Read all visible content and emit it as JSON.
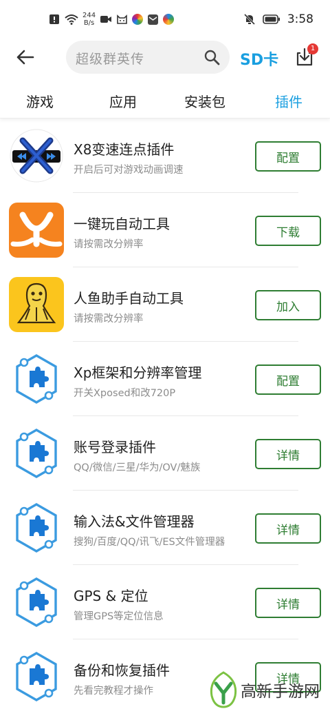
{
  "status_bar": {
    "net_speed_value": "244",
    "net_speed_unit": "B/s",
    "time": "3:58"
  },
  "header": {
    "search_placeholder": "超级群英传",
    "sd_card_label": "SD卡",
    "download_badge_count": "1"
  },
  "tabs": [
    {
      "label": "游戏",
      "active": false
    },
    {
      "label": "应用",
      "active": false
    },
    {
      "label": "安装包",
      "active": false
    },
    {
      "label": "插件",
      "active": true
    }
  ],
  "plugins": [
    {
      "icon": "x8-speed-icon",
      "title": "X8变速连点插件",
      "subtitle": "开启后可对游戏动画调速",
      "action": "配置"
    },
    {
      "icon": "y-logo-icon",
      "title": "一键玩自动工具",
      "subtitle": "请按需改分辨率",
      "action": "下载"
    },
    {
      "icon": "mermaid-icon",
      "title": "人鱼助手自动工具",
      "subtitle": "请按需改分辨率",
      "action": "加入"
    },
    {
      "icon": "puzzle-plugin-icon",
      "title": "Xp框架和分辨率管理",
      "subtitle": "开关Xposed和改720P",
      "action": "配置"
    },
    {
      "icon": "puzzle-plugin-icon",
      "title": "账号登录插件",
      "subtitle": "QQ/微信/三星/华为/OV/魅族",
      "action": "详情"
    },
    {
      "icon": "puzzle-plugin-icon",
      "title": "输入法&文件管理器",
      "subtitle": "搜狗/百度/QQ/讯飞/ES文件管理器",
      "action": "详情"
    },
    {
      "icon": "puzzle-plugin-icon",
      "title": "GPS & 定位",
      "subtitle": "管理GPS等定位信息",
      "action": "详情"
    },
    {
      "icon": "puzzle-plugin-icon",
      "title": "备份和恢复插件",
      "subtitle": "先看完教程才操作",
      "action": "详情"
    }
  ],
  "watermark": {
    "text": "高新手游网"
  },
  "colors": {
    "accent": "#1a9fe0",
    "button_green": "#2e7d32",
    "badge_red": "#e53935"
  }
}
